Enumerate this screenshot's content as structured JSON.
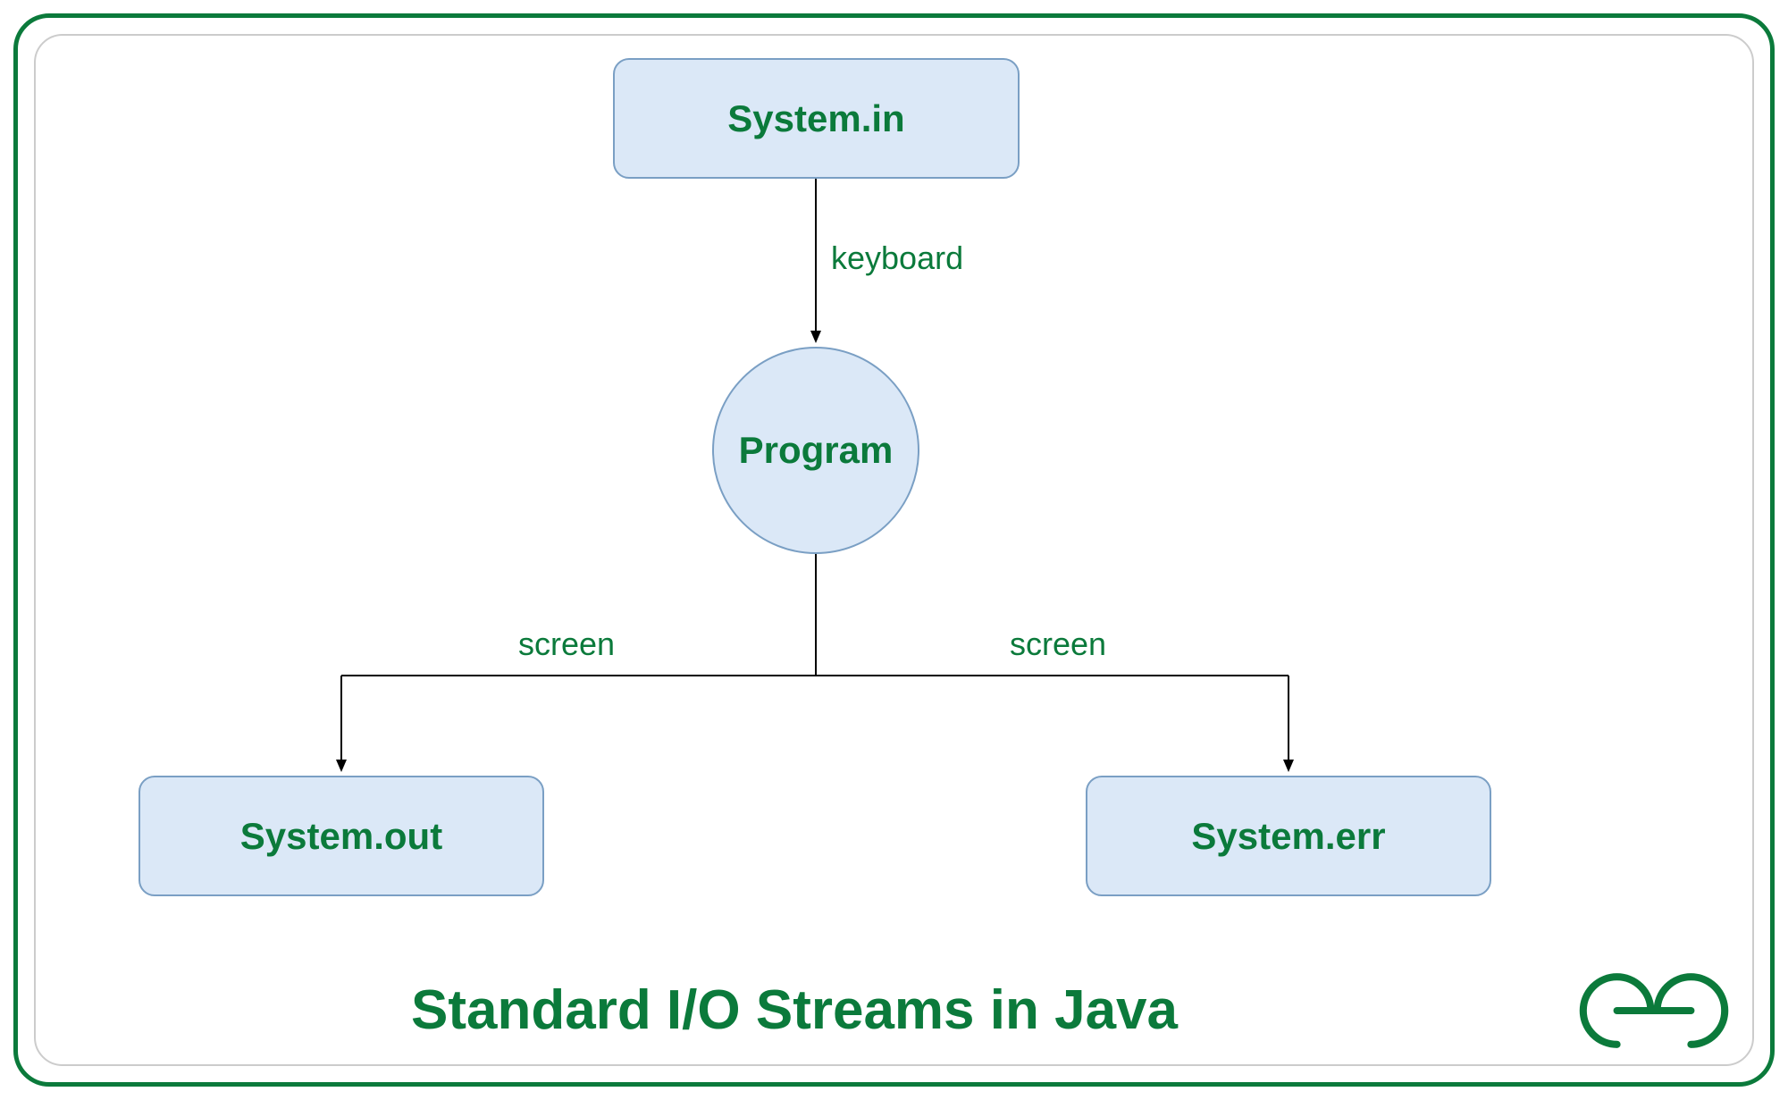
{
  "diagram": {
    "title": "Standard I/O Streams in Java",
    "nodes": {
      "system_in": "System.in",
      "program": "Program",
      "system_out": "System.out",
      "system_err": "System.err"
    },
    "edges": {
      "in_to_program": "keyboard",
      "program_to_out": "screen",
      "program_to_err": "screen"
    },
    "colors": {
      "accent": "#0b7a3b",
      "node_fill": "#dbe8f7",
      "node_border": "#7a9fc4"
    }
  }
}
